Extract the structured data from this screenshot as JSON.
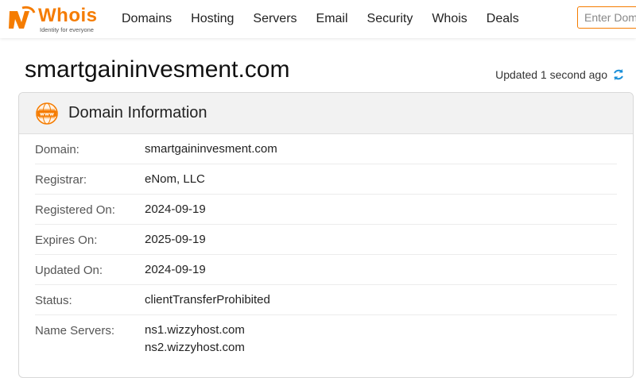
{
  "brand": {
    "name": "Whois",
    "tagline": "Identity for everyone",
    "accent_color": "#f57c00"
  },
  "nav": {
    "items": [
      {
        "label": "Domains"
      },
      {
        "label": "Hosting"
      },
      {
        "label": "Servers"
      },
      {
        "label": "Email"
      },
      {
        "label": "Security"
      },
      {
        "label": "Whois"
      },
      {
        "label": "Deals"
      }
    ]
  },
  "search": {
    "placeholder": "Enter Domain",
    "value": ""
  },
  "page": {
    "title": "smartgaininvesment.com",
    "updated_text": "Updated 1 second ago",
    "refresh_icon": "refresh-icon"
  },
  "card": {
    "title": "Domain Information",
    "icon": "www-icon",
    "rows": [
      {
        "label": "Domain:",
        "value": "smartgaininvesment.com"
      },
      {
        "label": "Registrar:",
        "value": "eNom, LLC"
      },
      {
        "label": "Registered On:",
        "value": "2024-09-19"
      },
      {
        "label": "Expires On:",
        "value": "2025-09-19"
      },
      {
        "label": "Updated On:",
        "value": "2024-09-19"
      },
      {
        "label": "Status:",
        "value": "clientTransferProhibited"
      }
    ],
    "name_servers": {
      "label": "Name Servers:",
      "values": [
        "ns1.wizzyhost.com",
        "ns2.wizzyhost.com"
      ]
    }
  }
}
